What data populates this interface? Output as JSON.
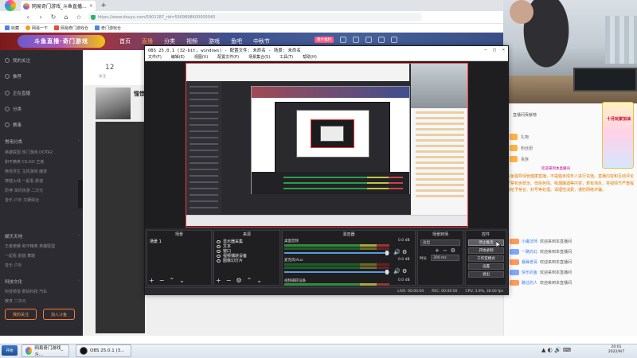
{
  "browser": {
    "tab_title": "网易奇门游戏_斗鱼直播...",
    "tab_close": "×",
    "new_tab": "+",
    "logo_label": "斗鱼",
    "back": "‹",
    "forward": "›",
    "reload": "↻",
    "home": "⌂",
    "star": "☆",
    "url": "https://www.douyu.com/5901287_rid=5909898600000040",
    "bookmarks": [
      "收藏",
      "网易一下",
      "网易奇门游戏仓",
      "奇门游戏仓"
    ]
  },
  "site": {
    "logo_text": "斗鱼直播·奇门游戏",
    "nav": [
      "首页",
      "直播",
      "分类",
      "视频",
      "游戏",
      "鱼吧",
      "中秋节"
    ],
    "active_nav_index": 1,
    "badge": "看片福利",
    "sidebar_top": [
      "我的关注",
      "推荐",
      "正在直播",
      "分类",
      "赛事"
    ],
    "sidebar_section1": "常用分类",
    "sidebar_cats1": [
      "英雄联盟 热门游戏 DOTA2",
      "和平精英 CS:GO 王者",
      "绝地求生 主机游戏 魔兽",
      "穿越火线 一起看 颜值",
      "原神 单机热游 二次元",
      "音乐 户外 文娱综合"
    ],
    "sidebar_section2": "娱乐天地",
    "sidebar_cats2": [
      "王者荣耀 和平精英 英雄联盟",
      "一起看 颜值 舞蹈",
      "音乐 户外"
    ],
    "sidebar_section3": "科技文化",
    "sidebar_cats3": [
      "科技频道 数码科技 汽车",
      "教育 二次元"
    ],
    "sidebar_btn1": "我的关注",
    "sidebar_btn2": "加入斗鱼",
    "room_num": "12",
    "room_sub": "关注",
    "room_title": "憧憬"
  },
  "chat": {
    "title": "直播间贡献榜",
    "promo": "十月玩家加油",
    "gifts": [
      "礼物",
      "粉丝团",
      "贵族"
    ],
    "hint": "欢迎来到本直播间",
    "notice": "斗鱼倡导绿色健康直播，不提倡未成年人进行充值。直播内容和互动评论严禁包含政治、低俗色情、吸烟酗酒等内容，若有违反，将视情节严重程度给予禁言、封号等处理。请理性消费，谨防网络诈骗。",
    "messages": [
      {
        "user": "小魔法师",
        "text": "欢迎来到本直播间"
      },
      {
        "user": "一路向北",
        "text": "欢迎来到本直播间"
      },
      {
        "user": "暴躁老哥",
        "text": "欢迎来到本直播间"
      },
      {
        "user": "快乐的鱼",
        "text": "欢迎来到本直播间"
      },
      {
        "user": "路过的人",
        "text": "欢迎来到本直播间"
      }
    ]
  },
  "obs": {
    "title": "OBS 25.0.1 (32-bit, windows) - 配置文件: 未命名 - 场景: 未命名",
    "min": "—",
    "max": "□",
    "close": "×",
    "menu": [
      "文件(F)",
      "编辑(E)",
      "视图(V)",
      "配置文件(P)",
      "场景集合(S)",
      "工具(T)",
      "帮助(H)"
    ],
    "docks": {
      "scenes": "场景",
      "sources": "来源",
      "mixer": "混音器",
      "transitions": "场景转场",
      "controls": "控件"
    },
    "scene_item": "场景 1",
    "sources": [
      "显示器采集",
      "文本",
      "窗口",
      "视频捕获设备",
      "图像幻灯片"
    ],
    "mixer": [
      {
        "label": "桌面音频",
        "db": "0.0 dB"
      },
      {
        "label": "麦克风/Aux",
        "db": "0.0 dB"
      },
      {
        "label": "视频捕获设备",
        "db": "0.0 dB"
      }
    ],
    "transition_select": "淡出",
    "transition_dur_label": "时长",
    "transition_dur": "300 ms",
    "controls": [
      "停止推流",
      "开始录制",
      "工作室模式",
      "设置",
      "退出"
    ],
    "status": [
      "LIVE: 00:00:00",
      "REC: 00:00:00",
      "CPU: 3.9%, 30.00 fps"
    ],
    "tools": "+ − ⚙ ^ v",
    "accent_colors": {
      "meter_green": "#2f8c3c",
      "meter_yellow": "#a8a83a",
      "meter_red": "#9c3434",
      "canvas_border": "#ff3b3b"
    }
  },
  "taskbar": {
    "start": "开始",
    "items": [
      "网易奇门游戏_斗...",
      "OBS 25.0.1 (3..."
    ],
    "tray": "▲ ◐ 🔊 ⌨",
    "clock_time": "20:01",
    "clock_date": "2022/9/7"
  }
}
